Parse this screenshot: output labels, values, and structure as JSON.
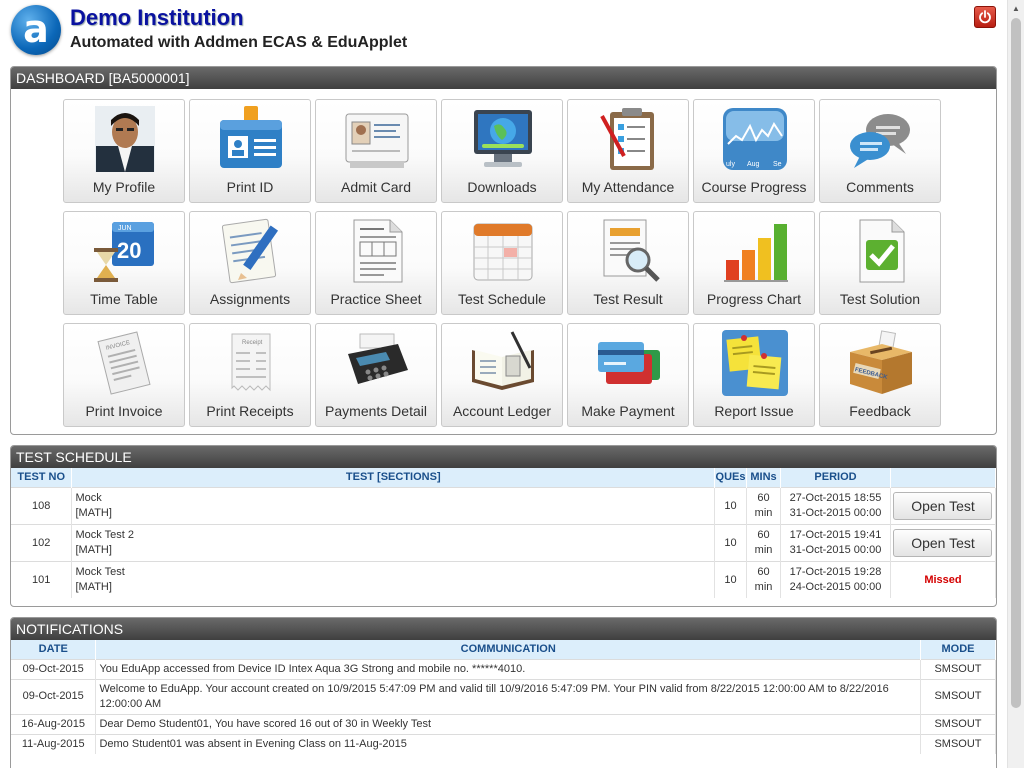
{
  "header": {
    "logo_letter": "a",
    "title": "Demo Institution",
    "subtitle": "Automated with Addmen ECAS & EduApplet",
    "logout_icon": "power-icon"
  },
  "dashboard": {
    "title": "DASHBOARD [BA5000001]",
    "tiles": [
      {
        "label": "My Profile",
        "icon": "profile-photo-icon"
      },
      {
        "label": "Print ID",
        "icon": "id-badge-icon"
      },
      {
        "label": "Admit Card",
        "icon": "admit-card-icon"
      },
      {
        "label": "Downloads",
        "icon": "monitor-globe-icon"
      },
      {
        "label": "My Attendance",
        "icon": "clipboard-checklist-icon"
      },
      {
        "label": "Course Progress",
        "icon": "progress-graph-icon"
      },
      {
        "label": "Comments",
        "icon": "speech-bubbles-icon"
      },
      {
        "label": "Time Table",
        "icon": "calendar-hourglass-icon"
      },
      {
        "label": "Assignments",
        "icon": "notepad-pencil-icon"
      },
      {
        "label": "Practice Sheet",
        "icon": "worksheet-icon"
      },
      {
        "label": "Test Schedule",
        "icon": "calendar-grid-icon"
      },
      {
        "label": "Test Result",
        "icon": "report-magnifier-icon"
      },
      {
        "label": "Progress Chart",
        "icon": "bar-chart-icon"
      },
      {
        "label": "Test Solution",
        "icon": "document-check-icon"
      },
      {
        "label": "Print Invoice",
        "icon": "invoice-icon"
      },
      {
        "label": "Print Receipts",
        "icon": "receipt-icon"
      },
      {
        "label": "Payments Detail",
        "icon": "card-terminal-icon"
      },
      {
        "label": "Account Ledger",
        "icon": "ledger-book-icon"
      },
      {
        "label": "Make Payment",
        "icon": "credit-cards-icon"
      },
      {
        "label": "Report Issue",
        "icon": "sticky-notes-icon"
      },
      {
        "label": "Feedback",
        "icon": "feedback-box-icon"
      }
    ],
    "calendar_day": "20",
    "calendar_month": "JUN",
    "graph_months": [
      "uly",
      "Aug",
      "Se"
    ],
    "receipt_text": "Receipt",
    "invoice_text": "INVOICE",
    "feedback_text": "FEEDBACK"
  },
  "test_schedule": {
    "title": "TEST SCHEDULE",
    "columns": [
      "TEST NO",
      "TEST [SECTIONS]",
      "QUEs",
      "MINs",
      "PERIOD"
    ],
    "rows": [
      {
        "no": "108",
        "name": "Mock",
        "section": "[MATH]",
        "ques": "10",
        "mins": "60",
        "mins_unit": "min",
        "from": "27-Oct-2015 18:55",
        "to": "31-Oct-2015 00:00",
        "action": "Open Test"
      },
      {
        "no": "102",
        "name": "Mock Test 2",
        "section": "[MATH]",
        "ques": "10",
        "mins": "60",
        "mins_unit": "min",
        "from": "17-Oct-2015 19:41",
        "to": "31-Oct-2015 00:00",
        "action": "Open Test"
      },
      {
        "no": "101",
        "name": "Mock Test",
        "section": "[MATH]",
        "ques": "10",
        "mins": "60",
        "mins_unit": "min",
        "from": "17-Oct-2015 19:28",
        "to": "24-Oct-2015 00:00",
        "status": "Missed"
      }
    ]
  },
  "notifications": {
    "title": "NOTIFICATIONS",
    "columns": [
      "DATE",
      "COMMUNICATION",
      "MODE"
    ],
    "rows": [
      {
        "date": "09-Oct-2015",
        "text": "You EduApp accessed from Device ID Intex Aqua 3G Strong and mobile no. ******4010.",
        "mode": "SMSOUT"
      },
      {
        "date": "09-Oct-2015",
        "text": "Welcome to EduApp. Your account created on 10/9/2015 5:47:09 PM and valid till 10/9/2016 5:47:09 PM. Your PIN valid from 8/22/2015 12:00:00 AM to 8/22/2016 12:00:00 AM",
        "mode": "SMSOUT"
      },
      {
        "date": "16-Aug-2015",
        "text": "Dear Demo Student01, You have scored 16 out of 30 in Weekly Test",
        "mode": "SMSOUT"
      },
      {
        "date": "11-Aug-2015",
        "text": "Demo Student01 was absent in Evening Class on 11-Aug-2015",
        "mode": "SMSOUT"
      }
    ]
  }
}
